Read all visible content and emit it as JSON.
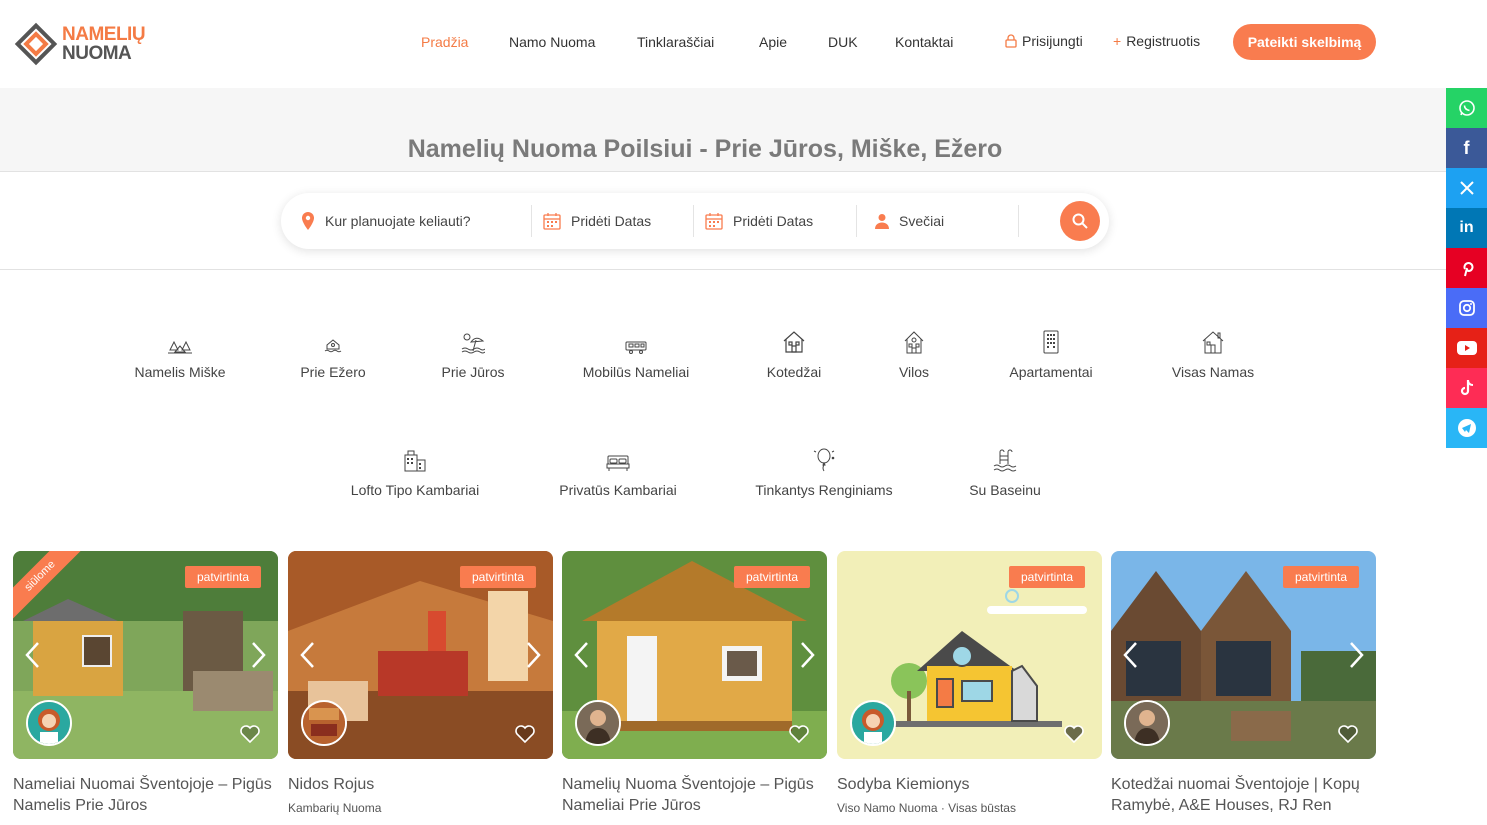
{
  "logo": {
    "line1": "NAMELIŲ",
    "line2": "NUOMA",
    "icon": "diamond-logo-icon"
  },
  "nav": {
    "items": [
      {
        "label": "Pradžia",
        "active": true
      },
      {
        "label": "Namo Nuoma",
        "active": false
      },
      {
        "label": "Tinklaraščiai",
        "active": false
      },
      {
        "label": "Apie",
        "active": false
      },
      {
        "label": "DUK",
        "active": false
      },
      {
        "label": "Kontaktai",
        "active": false
      }
    ],
    "login": "Prisijungti",
    "register": "Registruotis",
    "cta": "Pateikti skelbimą"
  },
  "hero": {
    "title": "Namelių Nuoma Poilsiui - Prie Jūros, Miške, Ežero"
  },
  "search": {
    "location_placeholder": "Kur planuojate keliauti?",
    "checkin": "Pridėti Datas",
    "checkout": "Pridėti Datas",
    "guests": "Svečiai"
  },
  "categories": [
    {
      "label": "Namelis Miške",
      "icon": "forest-cabin-icon"
    },
    {
      "label": "Prie Ežero",
      "icon": "lake-house-icon"
    },
    {
      "label": "Prie Jūros",
      "icon": "beach-icon"
    },
    {
      "label": "Mobilūs Nameliai",
      "icon": "mobile-home-icon"
    },
    {
      "label": "Kotedžai",
      "icon": "cottage-icon"
    },
    {
      "label": "Vilos",
      "icon": "villa-icon"
    },
    {
      "label": "Apartamentai",
      "icon": "apartment-icon"
    },
    {
      "label": "Visas Namas",
      "icon": "whole-house-icon"
    },
    {
      "label": "Lofto Tipo Kambariai",
      "icon": "loft-icon"
    },
    {
      "label": "Privatūs Kambariai",
      "icon": "bed-icon"
    },
    {
      "label": "Tinkantys Renginiams",
      "icon": "balloon-icon"
    },
    {
      "label": "Su Baseinu",
      "icon": "pool-icon"
    }
  ],
  "social": [
    {
      "name": "whatsapp-icon",
      "color": "#25d366"
    },
    {
      "name": "facebook-icon",
      "color": "#3b5998"
    },
    {
      "name": "x-twitter-icon",
      "color": "#1da1f2"
    },
    {
      "name": "linkedin-icon",
      "color": "#0077b5"
    },
    {
      "name": "pinterest-icon",
      "color": "#e60023"
    },
    {
      "name": "instagram-icon",
      "color": "#4a6cf7"
    },
    {
      "name": "youtube-icon",
      "color": "#e62117"
    },
    {
      "name": "tiktok-icon",
      "color": "#fe2c55"
    },
    {
      "name": "telegram-icon",
      "color": "#29b6f6"
    }
  ],
  "listings": [
    {
      "badge": "patvirtinta",
      "ribbon": "siūlome",
      "title": "Nameliai Nuomai Šventojoje – Pigūs Namelis Prie Jūros",
      "subtitle": ""
    },
    {
      "badge": "patvirtinta",
      "ribbon": "",
      "title": "Nidos Rojus",
      "subtitle": "Kambarių Nuoma"
    },
    {
      "badge": "patvirtinta",
      "ribbon": "",
      "title": "Namelių Nuoma Šventojoje – Pigūs Nameliai Prie Jūros",
      "subtitle": ""
    },
    {
      "badge": "patvirtinta",
      "ribbon": "",
      "title": "Sodyba Kiemionys",
      "subtitle": "Viso Namo Nuoma · Visas būstas"
    },
    {
      "badge": "patvirtinta",
      "ribbon": "",
      "title": "Kotedžai nuomai Šventojoje | Kopų Ramybė, A&E Houses, RJ Ren",
      "subtitle": ""
    }
  ],
  "colors": {
    "accent": "#f97c4f",
    "hero_bg": "#f6f6f6",
    "title_gray": "#7a7a7a"
  }
}
